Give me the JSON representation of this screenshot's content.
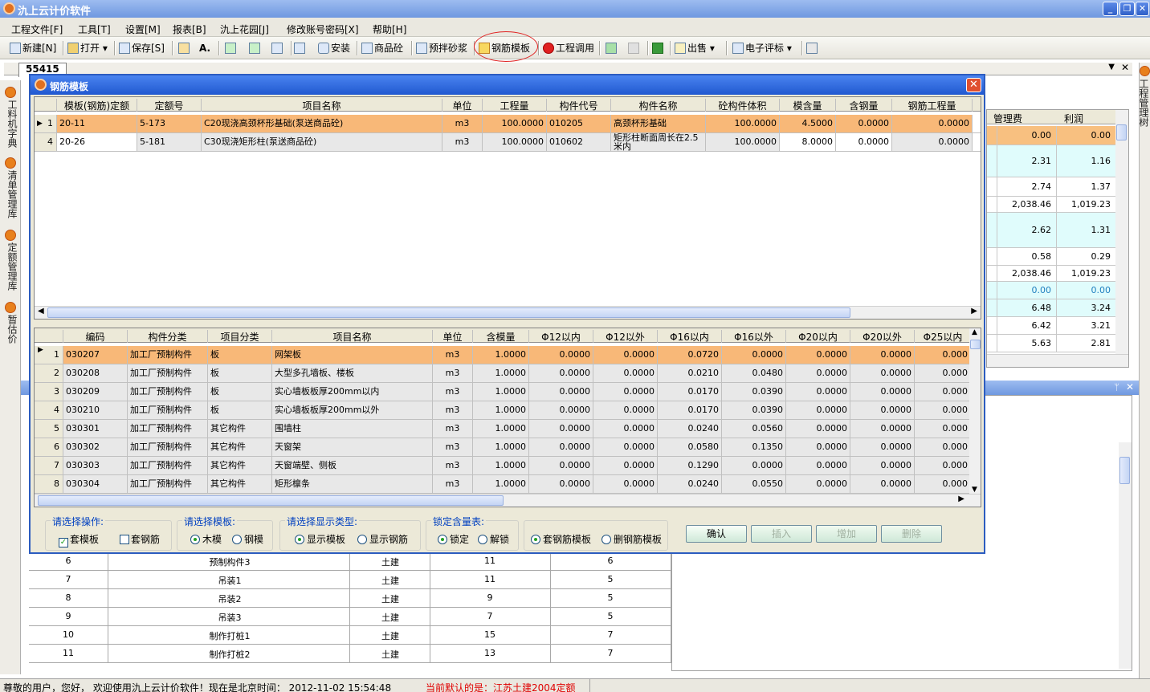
{
  "app": {
    "title": "氿上云计价软件"
  },
  "menu": [
    "工程文件[F]",
    "工具[T]",
    "设置[M]",
    "报表[B]",
    "氿上花园[J]",
    "修改账号密码[X]",
    "帮助[H]"
  ],
  "toolbar": {
    "new": "新建[N]",
    "open": "打开",
    "save": "保存[S]",
    "install": "安装",
    "goods": "商品砼",
    "premix": "预拌砂浆",
    "rebar_template": "钢筋模板",
    "project_call": "工程调用",
    "sell": "出售",
    "etender": "电子评标"
  },
  "doc_tab": "55415",
  "left_tabs": [
    "工料机字典",
    "清单管理库",
    "定额管理库",
    "暂估价"
  ],
  "right_tabs": [
    "工程管理树"
  ],
  "bg_grid": {
    "headers": [
      "管理费",
      "利润"
    ],
    "rows": [
      [
        "0.00",
        "0.00"
      ],
      [
        "2.31",
        "1.16"
      ],
      [
        "2.74",
        "1.37"
      ],
      [
        "2,038.46",
        "1,019.23"
      ],
      [
        "2.62",
        "1.31"
      ],
      [
        "0.58",
        "0.29"
      ],
      [
        "2,038.46",
        "1,019.23"
      ],
      [
        "0.00",
        "0.00"
      ],
      [
        "6.48",
        "3.24"
      ],
      [
        "6.42",
        "3.21"
      ],
      [
        "5.63",
        "2.81"
      ]
    ]
  },
  "bg_table": {
    "rows": [
      [
        "6",
        "预制构件3",
        "土建",
        "11",
        "6"
      ],
      [
        "7",
        "吊装1",
        "土建",
        "11",
        "5"
      ],
      [
        "8",
        "吊装2",
        "土建",
        "9",
        "5"
      ],
      [
        "9",
        "吊装3",
        "土建",
        "7",
        "5"
      ],
      [
        "10",
        "制作打桩1",
        "土建",
        "15",
        "7"
      ],
      [
        "11",
        "制作打桩2",
        "土建",
        "13",
        "7"
      ]
    ]
  },
  "dialog": {
    "title": "钢筋模板",
    "top_grid": {
      "headers": [
        "模板(钢筋)定额",
        "定额号",
        "项目名称",
        "单位",
        "工程量",
        "构件代号",
        "构件名称",
        "砼构件体积",
        "模含量",
        "含钢量",
        "钢筋工程量"
      ],
      "rows": [
        {
          "n": "1",
          "c": [
            "20-11",
            "5-173",
            "C20现浇高颈杯形基础(泵送商品砼)",
            "m3",
            "100.0000",
            "010205",
            "高颈杯形基础",
            "100.0000",
            "4.5000",
            "0.0000",
            "0.0000"
          ]
        },
        {
          "n": "4",
          "c": [
            "20-26",
            "5-181",
            "C30现浇矩形柱(泵送商品砼)",
            "m3",
            "100.0000",
            "010602",
            "矩形柱断面周长在2.5米内",
            "100.0000",
            "8.0000",
            "0.0000",
            "0.0000"
          ]
        }
      ]
    },
    "bottom_grid": {
      "headers": [
        "编码",
        "构件分类",
        "项目分类",
        "项目名称",
        "单位",
        "含模量",
        "Φ12以内",
        "Φ12以外",
        "Φ16以内",
        "Φ16以外",
        "Φ20以内",
        "Φ20以外",
        "Φ25以内"
      ],
      "rows": [
        {
          "n": "1",
          "c": [
            "030207",
            "加工厂预制构件",
            "板",
            "网架板",
            "m3",
            "1.0000",
            "0.0000",
            "0.0000",
            "0.0720",
            "0.0000",
            "0.0000",
            "0.0000",
            "0.000"
          ]
        },
        {
          "n": "2",
          "c": [
            "030208",
            "加工厂预制构件",
            "板",
            "大型多孔墙板、楼板",
            "m3",
            "1.0000",
            "0.0000",
            "0.0000",
            "0.0210",
            "0.0480",
            "0.0000",
            "0.0000",
            "0.000"
          ]
        },
        {
          "n": "3",
          "c": [
            "030209",
            "加工厂预制构件",
            "板",
            "实心墙板板厚200mm以内",
            "m3",
            "1.0000",
            "0.0000",
            "0.0000",
            "0.0170",
            "0.0390",
            "0.0000",
            "0.0000",
            "0.000"
          ]
        },
        {
          "n": "4",
          "c": [
            "030210",
            "加工厂预制构件",
            "板",
            "实心墙板板厚200mm以外",
            "m3",
            "1.0000",
            "0.0000",
            "0.0000",
            "0.0170",
            "0.0390",
            "0.0000",
            "0.0000",
            "0.000"
          ]
        },
        {
          "n": "5",
          "c": [
            "030301",
            "加工厂预制构件",
            "其它构件",
            "围墙柱",
            "m3",
            "1.0000",
            "0.0000",
            "0.0000",
            "0.0240",
            "0.0560",
            "0.0000",
            "0.0000",
            "0.000"
          ]
        },
        {
          "n": "6",
          "c": [
            "030302",
            "加工厂预制构件",
            "其它构件",
            "天窗架",
            "m3",
            "1.0000",
            "0.0000",
            "0.0000",
            "0.0580",
            "0.1350",
            "0.0000",
            "0.0000",
            "0.000"
          ]
        },
        {
          "n": "7",
          "c": [
            "030303",
            "加工厂预制构件",
            "其它构件",
            "天窗端壁、侧板",
            "m3",
            "1.0000",
            "0.0000",
            "0.0000",
            "0.1290",
            "0.0000",
            "0.0000",
            "0.0000",
            "0.000"
          ]
        },
        {
          "n": "8",
          "c": [
            "030304",
            "加工厂预制构件",
            "其它构件",
            "矩形檩条",
            "m3",
            "1.0000",
            "0.0000",
            "0.0000",
            "0.0240",
            "0.0550",
            "0.0000",
            "0.0000",
            "0.000"
          ]
        }
      ]
    },
    "groups": {
      "op_label": "请选择操作:",
      "op1": "套模板",
      "op2": "套钢筋",
      "tpl_label": "请选择模板:",
      "tpl1": "木模",
      "tpl2": "钢模",
      "disp_label": "请选择显示类型:",
      "disp1": "显示模板",
      "disp2": "显示钢筋",
      "lock_label": "锁定含量表:",
      "lock1": "锁定",
      "lock2": "解锁",
      "apply1": "套钢筋模板",
      "apply2": "删钢筋模板"
    },
    "buttons": {
      "confirm": "确认",
      "insert": "插入",
      "add": "增加",
      "delete": "删除"
    }
  },
  "status": {
    "welcome": "尊敬的用户，您好， 欢迎使用氿上云计价软件！现在是北京时间： 2012-11-02 15:54:48",
    "default": "当前默认的是：江苏土建2004定额"
  }
}
